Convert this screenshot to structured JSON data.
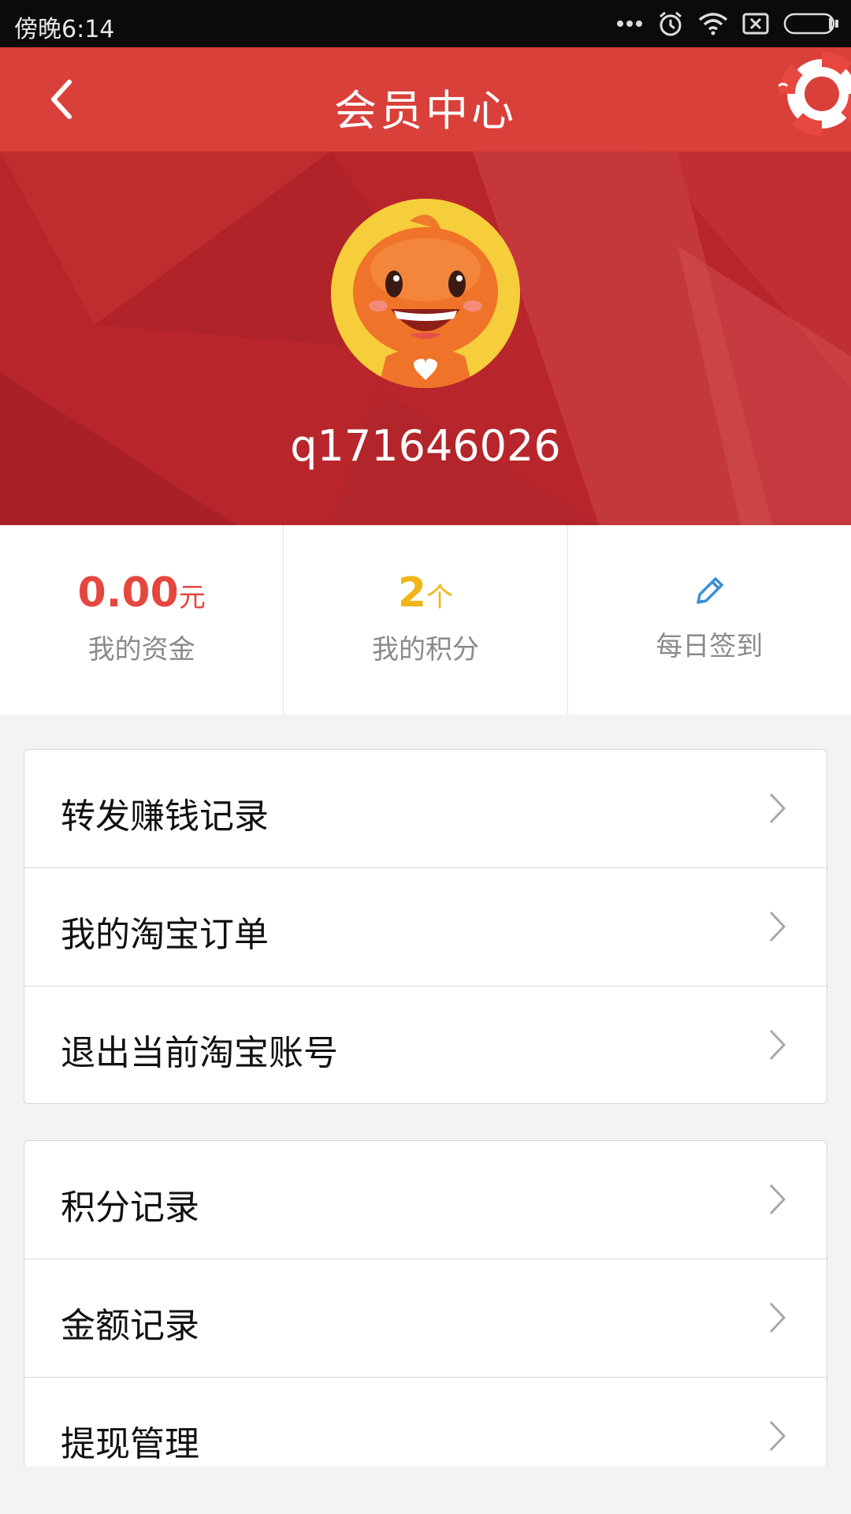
{
  "status_bar": {
    "time": "傍晚6:14",
    "icons": [
      "more-dots-icon",
      "alarm-icon",
      "wifi-icon",
      "no-sim-icon",
      "battery-icon"
    ]
  },
  "header": {
    "title": "会员中心",
    "back_icon": "back-arrow-icon",
    "right_icon": "lifebuoy-icon"
  },
  "profile": {
    "avatar": "mascot-avatar",
    "username": "q171646026"
  },
  "stats": [
    {
      "value": "0.00",
      "unit": "元",
      "label": "我的资金",
      "color": "#e5473f"
    },
    {
      "value": "2",
      "unit": "个",
      "label": "我的积分",
      "color": "#f0b516"
    },
    {
      "icon": "pencil-icon",
      "label": "每日签到",
      "color": "#3b8fd6"
    }
  ],
  "menu_group_1": [
    {
      "label": "转发赚钱记录"
    },
    {
      "label": "我的淘宝订单"
    },
    {
      "label": "退出当前淘宝账号"
    }
  ],
  "menu_group_2": [
    {
      "label": "积分记录"
    },
    {
      "label": "金额记录"
    },
    {
      "label": "提现管理"
    }
  ],
  "colors": {
    "header": "#d9403a",
    "banner": "#b8262c",
    "money": "#e5473f",
    "points": "#f0b516",
    "signin": "#3b8fd6"
  }
}
